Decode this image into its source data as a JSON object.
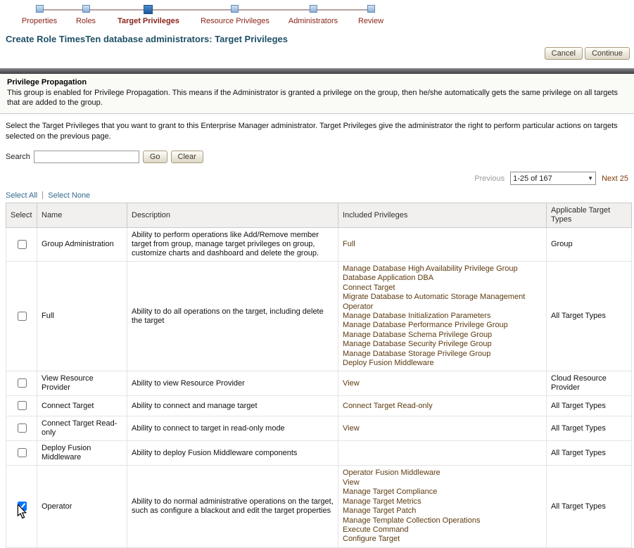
{
  "train": {
    "steps": [
      {
        "label": "Properties",
        "state": "visited"
      },
      {
        "label": "Roles",
        "state": "visited"
      },
      {
        "label": "Target Privileges",
        "state": "current"
      },
      {
        "label": "Resource Privileges",
        "state": "future"
      },
      {
        "label": "Administrators",
        "state": "future"
      },
      {
        "label": "Review",
        "state": "future"
      }
    ]
  },
  "page_title": "Create Role TimesTen database administrators: Target Privileges",
  "actions": {
    "cancel": "Cancel",
    "continue": "Continue"
  },
  "privilege_propagation": {
    "title": "Privilege Propagation",
    "body": "This group is enabled for Privilege Propagation. This means if the Administrator is granted a privilege on the group, then he/she automatically gets the same privilege on all targets that are added to the group."
  },
  "instructions": "Select the Target Privileges that you want to grant to this Enterprise Manager administrator. Target Privileges give the administrator the right to perform particular actions on targets selected on the previous page.",
  "search": {
    "label": "Search",
    "value": "",
    "go": "Go",
    "clear": "Clear"
  },
  "pagination": {
    "previous": "Previous",
    "range": "1-25 of 167",
    "next": "Next 25"
  },
  "selection_links": {
    "select_all": "Select All",
    "select_none": "Select None"
  },
  "colors": {
    "link": "#336a8d",
    "step_label": "#8a251a",
    "title": "#205067",
    "privilege_text": "#5d3b10"
  },
  "table": {
    "headers": [
      "Select",
      "Name",
      "Description",
      "Included Privileges",
      "Applicable Target Types"
    ],
    "rows": [
      {
        "checked": false,
        "name": "Group Administration",
        "description": "Ability to perform operations like Add/Remove member target from group, manage target privileges on group, customize charts and dashboard and delete the group.",
        "included": [
          "Full"
        ],
        "applicable": "Group"
      },
      {
        "checked": false,
        "name": "Full",
        "description": "Ability to do all operations on the target, including delete the target",
        "included": [
          "Manage Database High Availability Privilege Group",
          "Database Application DBA",
          "Connect Target",
          "Migrate Database to Automatic Storage Management",
          "Operator",
          "Manage Database Initialization Parameters",
          "Manage Database Performance Privilege Group",
          "Manage Database Schema Privilege Group",
          "Manage Database Security Privilege Group",
          "Manage Database Storage Privilege Group",
          "Deploy Fusion Middleware"
        ],
        "applicable": "All Target Types"
      },
      {
        "checked": false,
        "name": "View Resource Provider",
        "description": "Ability to view Resource Provider",
        "included": [
          "View"
        ],
        "applicable": "Cloud Resource Provider"
      },
      {
        "checked": false,
        "name": "Connect Target",
        "description": "Ability to connect and manage target",
        "included": [
          "Connect Target Read-only"
        ],
        "applicable": "All Target Types"
      },
      {
        "checked": false,
        "name": "Connect Target Read-only",
        "description": "Ability to connect to target in read-only mode",
        "included": [
          "View"
        ],
        "applicable": "All Target Types"
      },
      {
        "checked": false,
        "name": "Deploy Fusion Middleware",
        "description": "Ability to deploy Fusion Middleware components",
        "included": [],
        "applicable": "All Target Types"
      },
      {
        "checked": true,
        "cursor": true,
        "name": "Operator",
        "description": "Ability to do normal administrative operations on the target, such as configure a blackout and edit the target properties",
        "included": [
          "Operator Fusion Middleware",
          "View",
          "Manage Target Compliance",
          "Manage Target Metrics",
          "Manage Target Patch",
          "Manage Template Collection Operations",
          "Execute Command",
          "Configure Target"
        ],
        "applicable": "All Target Types"
      }
    ]
  }
}
